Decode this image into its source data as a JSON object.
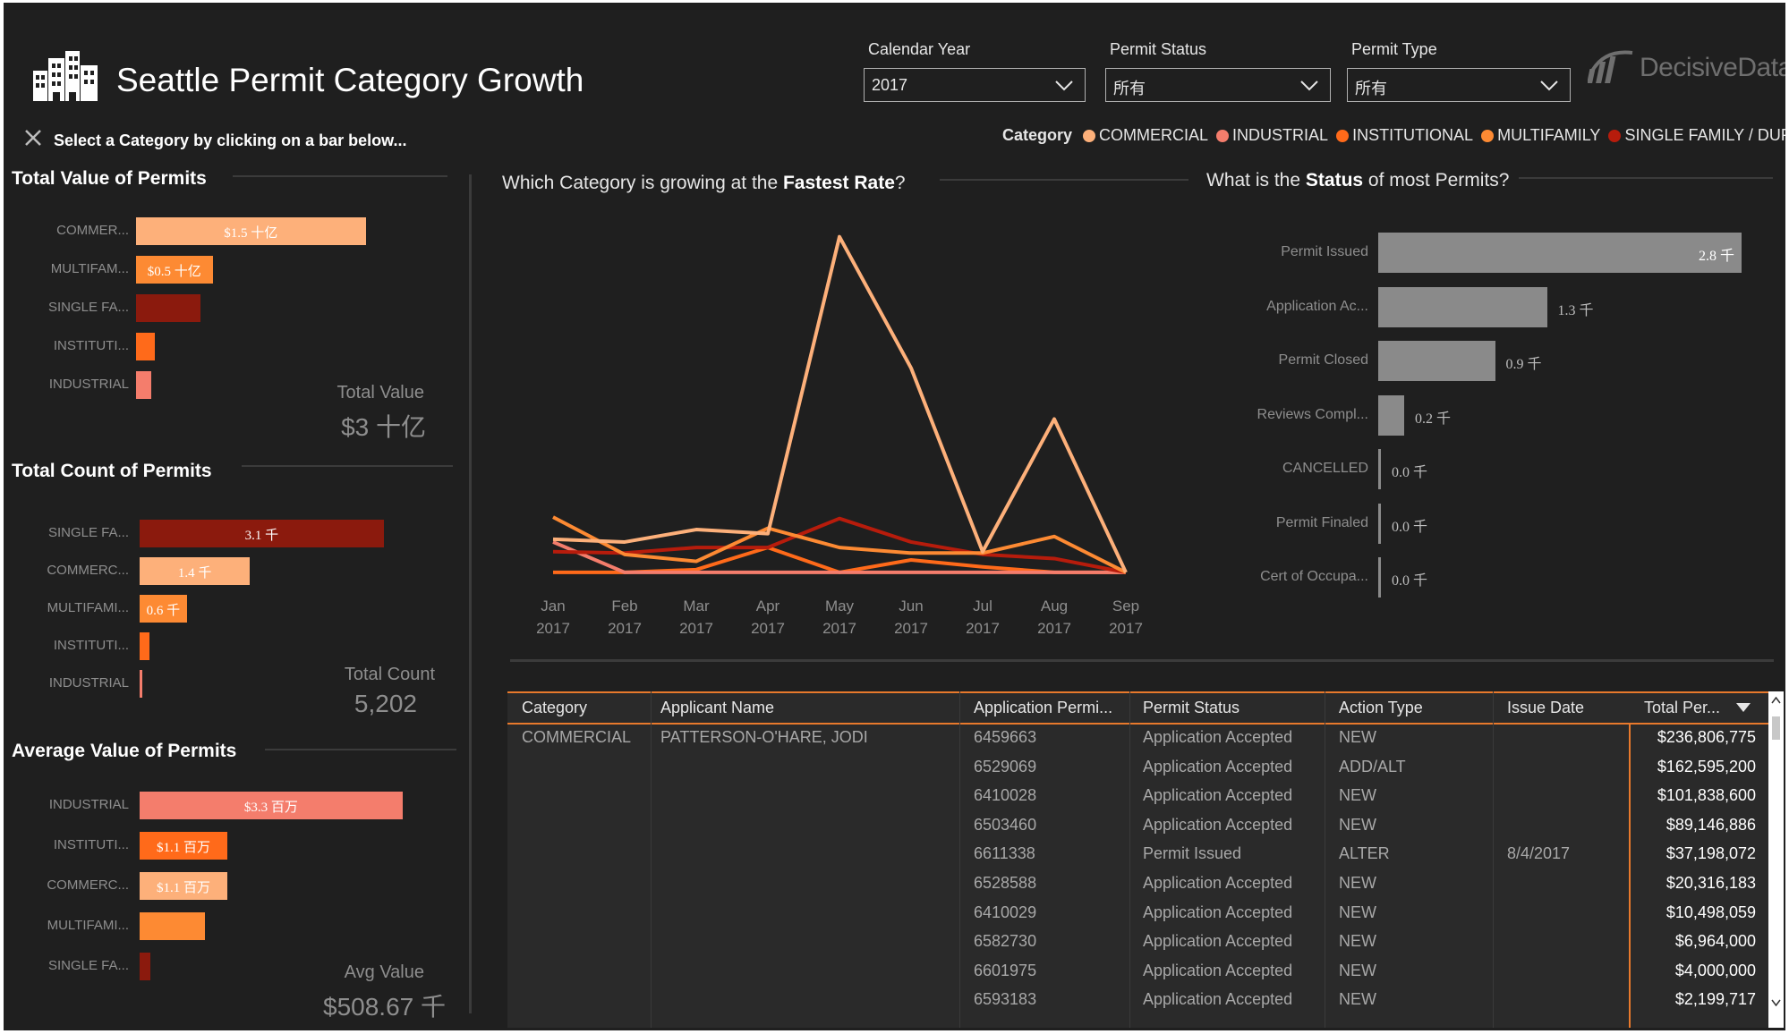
{
  "header": {
    "title": "Seattle Permit Category Growth",
    "hint": "Select a Category by clicking on a bar below...",
    "brand": "DecisiveData"
  },
  "filters": [
    {
      "label": "Calendar Year",
      "value": "2017"
    },
    {
      "label": "Permit Status",
      "value": "所有"
    },
    {
      "label": "Permit Type",
      "value": "所有"
    }
  ],
  "legend": {
    "title": "Category",
    "items": [
      {
        "name": "COMMERCIAL",
        "color": "#fdb07a"
      },
      {
        "name": "INDUSTRIAL",
        "color": "#f47d6c"
      },
      {
        "name": "INSTITUTIONAL",
        "color": "#ff6a1a"
      },
      {
        "name": "MULTIFAMILY",
        "color": "#fd8a33"
      },
      {
        "name": "SINGLE FAMILY / DUPLEX",
        "color": "#b71c0c"
      }
    ]
  },
  "total_value": {
    "title": "Total Value of Permits",
    "bars": [
      {
        "label": "COMMER...",
        "value": 1.5,
        "display": "$1.5 十亿",
        "color": "#fdb07a"
      },
      {
        "label": "MULTIFAM...",
        "value": 0.5,
        "display": "$0.5 十亿",
        "color": "#fd8a33"
      },
      {
        "label": "SINGLE FA...",
        "value": 0.42,
        "display": "",
        "color": "#8b1a0d"
      },
      {
        "label": "INSTITUTI...",
        "value": 0.12,
        "display": "",
        "color": "#ff6a1a"
      },
      {
        "label": "INDUSTRIAL",
        "value": 0.1,
        "display": "",
        "color": "#f47d6c"
      }
    ],
    "kpi_label": "Total Value",
    "kpi_value": "$3 十亿"
  },
  "total_count": {
    "title": "Total Count of Permits",
    "bars": [
      {
        "label": "SINGLE FA...",
        "value": 3.1,
        "display": "3.1 千",
        "color": "#8b1a0d"
      },
      {
        "label": "COMMERC...",
        "value": 1.4,
        "display": "1.4 千",
        "color": "#fdb07a"
      },
      {
        "label": "MULTIFAMI...",
        "value": 0.6,
        "display": "0.6 千",
        "color": "#fd8a33"
      },
      {
        "label": "INSTITUTI...",
        "value": 0.12,
        "display": "",
        "color": "#ff6a1a"
      },
      {
        "label": "INDUSTRIAL",
        "value": 0.03,
        "display": "",
        "color": "#f47d6c"
      }
    ],
    "kpi_label": "Total Count",
    "kpi_value": "5,202"
  },
  "avg_value": {
    "title": "Average Value of Permits",
    "bars": [
      {
        "label": "INDUSTRIAL",
        "value": 3.3,
        "display": "$3.3 百万",
        "color": "#f47d6c"
      },
      {
        "label": "INSTITUTI...",
        "value": 1.1,
        "display": "$1.1 百万",
        "color": "#ff6a1a"
      },
      {
        "label": "COMMERC...",
        "value": 1.1,
        "display": "$1.1 百万",
        "color": "#fdb07a"
      },
      {
        "label": "MULTIFAMI...",
        "value": 0.82,
        "display": "",
        "color": "#fd8a33"
      },
      {
        "label": "SINGLE FA...",
        "value": 0.13,
        "display": "",
        "color": "#8b1a0d"
      }
    ],
    "kpi_label": "Avg Value",
    "kpi_value": "$508.67 千"
  },
  "growth": {
    "title_pre": "Which Category is growing at the ",
    "title_bold": "Fastest Rate",
    "title_post": "?"
  },
  "status": {
    "title_pre": "What is the ",
    "title_bold": "Status",
    "title_post": " of most Permits?"
  },
  "chart_data": [
    {
      "type": "line",
      "x": [
        "Jan 2017",
        "Feb 2017",
        "Mar 2017",
        "Apr 2017",
        "May 2017",
        "Jun 2017",
        "Jul 2017",
        "Aug 2017",
        "Sep 2017"
      ],
      "x_ticks": [
        {
          "month": "Jan",
          "year": "2017"
        },
        {
          "month": "Feb",
          "year": "2017"
        },
        {
          "month": "Mar",
          "year": "2017"
        },
        {
          "month": "Apr",
          "year": "2017"
        },
        {
          "month": "May",
          "year": "2017"
        },
        {
          "month": "Jun",
          "year": "2017"
        },
        {
          "month": "Jul",
          "year": "2017"
        },
        {
          "month": "Aug",
          "year": "2017"
        },
        {
          "month": "Sep",
          "year": "2017"
        }
      ],
      "series": [
        {
          "name": "COMMERCIAL",
          "color": "#fdb07a",
          "values": [
            26,
            24,
            33,
            30,
            245,
            150,
            17,
            113,
            2
          ]
        },
        {
          "name": "MULTIFAMILY",
          "color": "#fd8a33",
          "values": [
            42,
            15,
            10,
            34,
            20,
            16,
            16,
            28,
            2
          ]
        },
        {
          "name": "SINGLE FAMILY / DUPLEX",
          "color": "#b71c0c",
          "values": [
            17,
            16,
            20,
            20,
            41,
            24,
            15,
            12,
            2
          ]
        },
        {
          "name": "INDUSTRIAL",
          "color": "#f47d6c",
          "values": [
            24,
            2,
            2,
            2,
            2,
            2,
            2,
            2,
            2
          ]
        },
        {
          "name": "INSTITUTIONAL",
          "color": "#ff6a1a",
          "values": [
            2,
            2,
            4,
            20,
            2,
            11,
            6,
            2,
            2
          ]
        }
      ],
      "ylim": [
        0,
        250
      ],
      "grid": false
    },
    {
      "type": "bar",
      "orientation": "horizontal",
      "categories": [
        "Permit Issued",
        "Application Ac...",
        "Permit Closed",
        "Reviews Compl...",
        "CANCELLED",
        "Permit Finaled",
        "Cert of Occupa..."
      ],
      "values": [
        2.8,
        1.3,
        0.9,
        0.2,
        0.0,
        0.0,
        0.0
      ],
      "labels": [
        "2.8 千",
        "1.3 千",
        "0.9 千",
        "0.2 千",
        "0.0 千",
        "0.0 千",
        "0.0 千"
      ],
      "color": "#8a8a8a"
    }
  ],
  "table": {
    "columns": [
      "Category",
      "Applicant Name",
      "Application Permi...",
      "Permit Status",
      "Action Type",
      "Issue Date",
      "Total Per..."
    ],
    "rows": [
      {
        "category": "COMMERCIAL",
        "applicant": "PATTERSON-O'HARE, JODI",
        "permit": "6459663",
        "status": "Application Accepted",
        "action": "NEW",
        "issue": "",
        "total": "$236,806,775"
      },
      {
        "category": "",
        "applicant": "",
        "permit": "6529069",
        "status": "Application Accepted",
        "action": "ADD/ALT",
        "issue": "",
        "total": "$162,595,200"
      },
      {
        "category": "",
        "applicant": "",
        "permit": "6410028",
        "status": "Application Accepted",
        "action": "NEW",
        "issue": "",
        "total": "$101,838,600"
      },
      {
        "category": "",
        "applicant": "",
        "permit": "6503460",
        "status": "Application Accepted",
        "action": "NEW",
        "issue": "",
        "total": "$89,146,886"
      },
      {
        "category": "",
        "applicant": "",
        "permit": "6611338",
        "status": "Permit Issued",
        "action": "ALTER",
        "issue": "8/4/2017",
        "total": "$37,198,072"
      },
      {
        "category": "",
        "applicant": "",
        "permit": "6528588",
        "status": "Application Accepted",
        "action": "NEW",
        "issue": "",
        "total": "$20,316,183"
      },
      {
        "category": "",
        "applicant": "",
        "permit": "6410029",
        "status": "Application Accepted",
        "action": "NEW",
        "issue": "",
        "total": "$10,498,059"
      },
      {
        "category": "",
        "applicant": "",
        "permit": "6582730",
        "status": "Application Accepted",
        "action": "NEW",
        "issue": "",
        "total": "$6,964,000"
      },
      {
        "category": "",
        "applicant": "",
        "permit": "6601975",
        "status": "Application Accepted",
        "action": "NEW",
        "issue": "",
        "total": "$4,000,000"
      },
      {
        "category": "",
        "applicant": "",
        "permit": "6593183",
        "status": "Application Accepted",
        "action": "NEW",
        "issue": "",
        "total": "$2,199,717"
      }
    ]
  }
}
